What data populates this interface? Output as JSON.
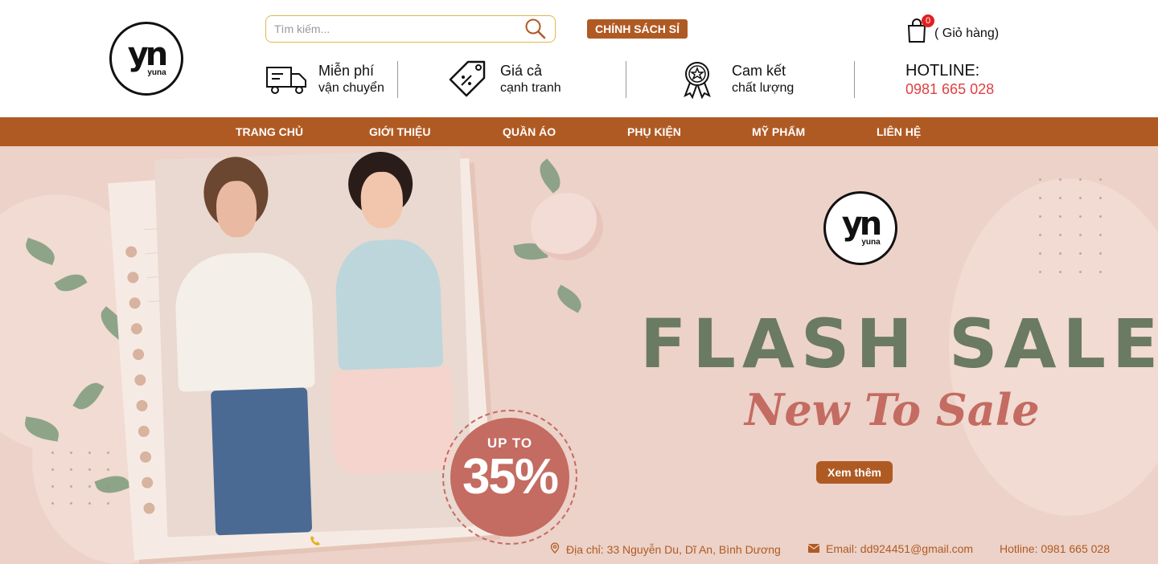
{
  "header": {
    "logo_text": "yn",
    "logo_word": "yuna",
    "search_placeholder": "Tìm kiếm...",
    "policy_button": "CHÍNH SÁCH SỈ",
    "cart_count": "0",
    "cart_label": "( Giỏ hàng)",
    "features": [
      {
        "title": "Miễn phí",
        "subtitle": "vận chuyển",
        "icon": "truck-icon"
      },
      {
        "title": "Giá cả",
        "subtitle": "cạnh tranh",
        "icon": "price-tag-icon"
      },
      {
        "title": "Cam kết",
        "subtitle": "chất lượng",
        "icon": "quality-badge-icon"
      }
    ],
    "hotline_label": "HOTLINE:",
    "hotline_number": "0981 665 028"
  },
  "nav": {
    "items": [
      "TRANG CHỦ",
      "GIỚI THIỆU",
      "QUẦN ÁO",
      "PHỤ KIỆN",
      "MỸ PHẨM",
      "LIÊN HỆ"
    ]
  },
  "hero": {
    "logo_text": "yn",
    "logo_word": "yuna",
    "headline": "FLASH SALE",
    "subheadline": "New To Sale",
    "button": "Xem thêm",
    "badge_top": "UP TO",
    "badge_value": "35%"
  },
  "footer_bar": {
    "address": "Địa chỉ: 33 Nguyễn Du, Dĩ An, Bình Dương",
    "email": "Email: dd924451@gmail.com",
    "hotline": "Hotline: 0981 665 028"
  },
  "colors": {
    "brand": "#b05a23",
    "hero_bg": "#ecd2c8",
    "headline": "#6b7a62",
    "accent": "#c46b62",
    "hotline": "#e04040"
  }
}
